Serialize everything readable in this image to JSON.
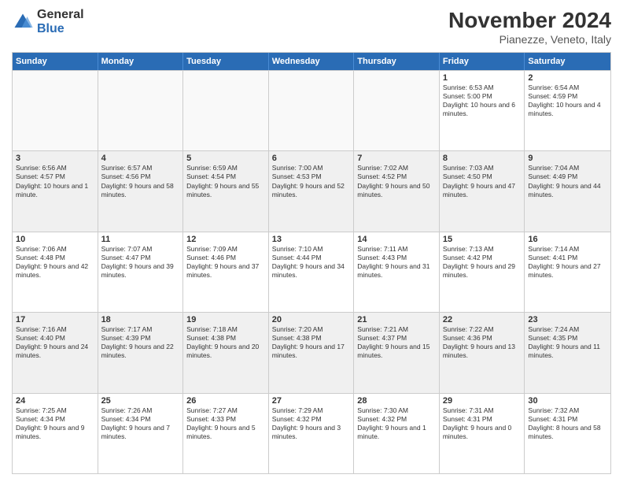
{
  "logo": {
    "general": "General",
    "blue": "Blue"
  },
  "title": "November 2024",
  "location": "Pianezze, Veneto, Italy",
  "days_of_week": [
    "Sunday",
    "Monday",
    "Tuesday",
    "Wednesday",
    "Thursday",
    "Friday",
    "Saturday"
  ],
  "weeks": [
    [
      {
        "day": "",
        "info": ""
      },
      {
        "day": "",
        "info": ""
      },
      {
        "day": "",
        "info": ""
      },
      {
        "day": "",
        "info": ""
      },
      {
        "day": "",
        "info": ""
      },
      {
        "day": "1",
        "info": "Sunrise: 6:53 AM\nSunset: 5:00 PM\nDaylight: 10 hours and 6 minutes."
      },
      {
        "day": "2",
        "info": "Sunrise: 6:54 AM\nSunset: 4:59 PM\nDaylight: 10 hours and 4 minutes."
      }
    ],
    [
      {
        "day": "3",
        "info": "Sunrise: 6:56 AM\nSunset: 4:57 PM\nDaylight: 10 hours and 1 minute."
      },
      {
        "day": "4",
        "info": "Sunrise: 6:57 AM\nSunset: 4:56 PM\nDaylight: 9 hours and 58 minutes."
      },
      {
        "day": "5",
        "info": "Sunrise: 6:59 AM\nSunset: 4:54 PM\nDaylight: 9 hours and 55 minutes."
      },
      {
        "day": "6",
        "info": "Sunrise: 7:00 AM\nSunset: 4:53 PM\nDaylight: 9 hours and 52 minutes."
      },
      {
        "day": "7",
        "info": "Sunrise: 7:02 AM\nSunset: 4:52 PM\nDaylight: 9 hours and 50 minutes."
      },
      {
        "day": "8",
        "info": "Sunrise: 7:03 AM\nSunset: 4:50 PM\nDaylight: 9 hours and 47 minutes."
      },
      {
        "day": "9",
        "info": "Sunrise: 7:04 AM\nSunset: 4:49 PM\nDaylight: 9 hours and 44 minutes."
      }
    ],
    [
      {
        "day": "10",
        "info": "Sunrise: 7:06 AM\nSunset: 4:48 PM\nDaylight: 9 hours and 42 minutes."
      },
      {
        "day": "11",
        "info": "Sunrise: 7:07 AM\nSunset: 4:47 PM\nDaylight: 9 hours and 39 minutes."
      },
      {
        "day": "12",
        "info": "Sunrise: 7:09 AM\nSunset: 4:46 PM\nDaylight: 9 hours and 37 minutes."
      },
      {
        "day": "13",
        "info": "Sunrise: 7:10 AM\nSunset: 4:44 PM\nDaylight: 9 hours and 34 minutes."
      },
      {
        "day": "14",
        "info": "Sunrise: 7:11 AM\nSunset: 4:43 PM\nDaylight: 9 hours and 31 minutes."
      },
      {
        "day": "15",
        "info": "Sunrise: 7:13 AM\nSunset: 4:42 PM\nDaylight: 9 hours and 29 minutes."
      },
      {
        "day": "16",
        "info": "Sunrise: 7:14 AM\nSunset: 4:41 PM\nDaylight: 9 hours and 27 minutes."
      }
    ],
    [
      {
        "day": "17",
        "info": "Sunrise: 7:16 AM\nSunset: 4:40 PM\nDaylight: 9 hours and 24 minutes."
      },
      {
        "day": "18",
        "info": "Sunrise: 7:17 AM\nSunset: 4:39 PM\nDaylight: 9 hours and 22 minutes."
      },
      {
        "day": "19",
        "info": "Sunrise: 7:18 AM\nSunset: 4:38 PM\nDaylight: 9 hours and 20 minutes."
      },
      {
        "day": "20",
        "info": "Sunrise: 7:20 AM\nSunset: 4:38 PM\nDaylight: 9 hours and 17 minutes."
      },
      {
        "day": "21",
        "info": "Sunrise: 7:21 AM\nSunset: 4:37 PM\nDaylight: 9 hours and 15 minutes."
      },
      {
        "day": "22",
        "info": "Sunrise: 7:22 AM\nSunset: 4:36 PM\nDaylight: 9 hours and 13 minutes."
      },
      {
        "day": "23",
        "info": "Sunrise: 7:24 AM\nSunset: 4:35 PM\nDaylight: 9 hours and 11 minutes."
      }
    ],
    [
      {
        "day": "24",
        "info": "Sunrise: 7:25 AM\nSunset: 4:34 PM\nDaylight: 9 hours and 9 minutes."
      },
      {
        "day": "25",
        "info": "Sunrise: 7:26 AM\nSunset: 4:34 PM\nDaylight: 9 hours and 7 minutes."
      },
      {
        "day": "26",
        "info": "Sunrise: 7:27 AM\nSunset: 4:33 PM\nDaylight: 9 hours and 5 minutes."
      },
      {
        "day": "27",
        "info": "Sunrise: 7:29 AM\nSunset: 4:32 PM\nDaylight: 9 hours and 3 minutes."
      },
      {
        "day": "28",
        "info": "Sunrise: 7:30 AM\nSunset: 4:32 PM\nDaylight: 9 hours and 1 minute."
      },
      {
        "day": "29",
        "info": "Sunrise: 7:31 AM\nSunset: 4:31 PM\nDaylight: 9 hours and 0 minutes."
      },
      {
        "day": "30",
        "info": "Sunrise: 7:32 AM\nSunset: 4:31 PM\nDaylight: 8 hours and 58 minutes."
      }
    ]
  ]
}
